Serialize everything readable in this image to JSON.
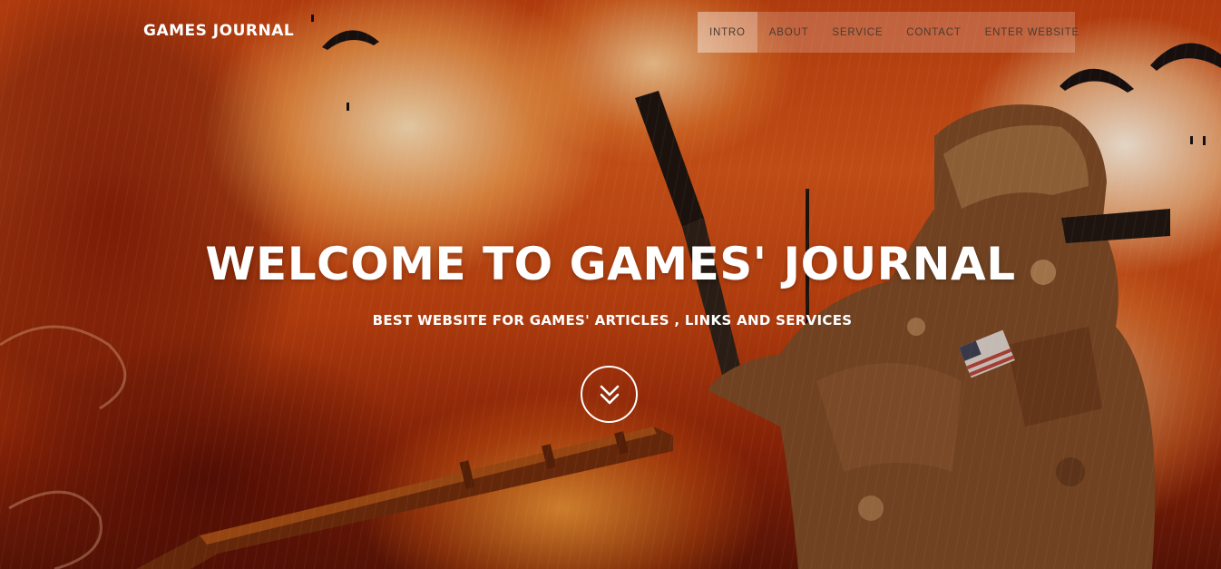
{
  "brand": {
    "title": "GAMES JOURNAL"
  },
  "nav": {
    "items": [
      {
        "label": "INTRO"
      },
      {
        "label": "ABOUT"
      },
      {
        "label": "SERVICE"
      },
      {
        "label": "CONTACT"
      },
      {
        "label": "ENTER WEBSITE"
      }
    ],
    "active_index": 0
  },
  "hero": {
    "title": "WELCOME TO GAMES' JOURNAL",
    "subtitle": "BEST WEBSITE FOR GAMES' ARTICLES , LINKS AND SERVICES",
    "scroll_icon": "double-chevron-down-icon",
    "background_image": "soldier-battlefield-fire-scene"
  },
  "colors": {
    "text_primary": "#ffffff",
    "nav_text": "#4a3a33",
    "background_fire": "#c2410f"
  }
}
